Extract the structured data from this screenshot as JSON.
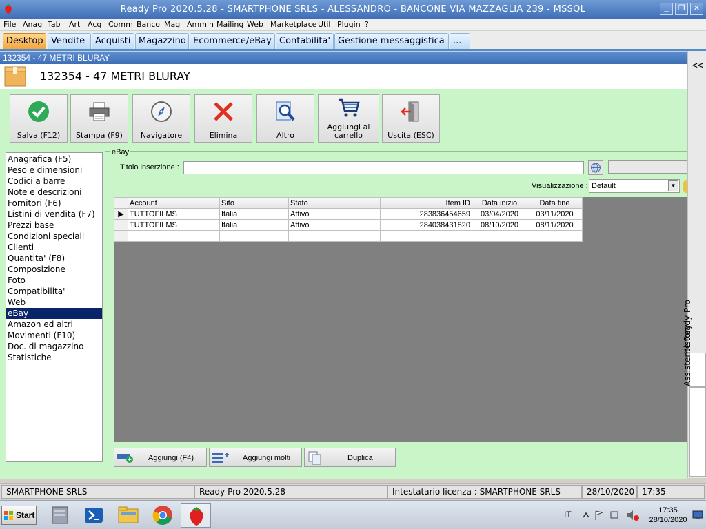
{
  "window": {
    "title": "Ready Pro 2020.5.28 - SMARTPHONE SRLS - ALESSANDRO - BANCONE VIA MAZZAGLIA 239 - MSSQL",
    "minimize": "_",
    "restore": "❐",
    "close": "✕"
  },
  "menu": [
    "File",
    "Anag",
    "Tab",
    "Art",
    "Acq",
    "Comm",
    "Banco",
    "Mag",
    "Ammin",
    "Mailing",
    "Web",
    "Marketplace",
    "Util",
    "Plugin",
    "?"
  ],
  "tabs": [
    "Desktop",
    "Vendite",
    "Acquisti",
    "Magazzino",
    "Ecommerce/eBay",
    "Contabilita'",
    "Gestione messaggistica",
    "..."
  ],
  "active_tab": "Desktop",
  "form": {
    "caption": "132354 - 47 METRI BLURAY",
    "title": "132354 - 47 METRI BLURAY"
  },
  "toolbar": {
    "save": "Salva (F12)",
    "print": "Stampa (F9)",
    "navigator": "Navigatore",
    "delete": "Elimina",
    "other": "Altro",
    "cart_line1": "Aggiungi al",
    "cart_line2": "carrello",
    "exit": "Uscita (ESC)"
  },
  "sidebar": {
    "items": [
      "Anagrafica (F5)",
      "Peso e dimensioni",
      "Codici a barre",
      "Note e descrizioni",
      "Fornitori (F6)",
      "Listini di vendita (F7)",
      "Prezzi base",
      "Condizioni speciali",
      "Clienti",
      "Quantita' (F8)",
      "Composizione",
      "Foto",
      "Compatibilita'",
      "Web",
      "eBay",
      "Amazon ed altri",
      "Movimenti (F10)",
      "Doc. di magazzino",
      "Statistiche"
    ],
    "selected": "eBay"
  },
  "ebay": {
    "group_label": "eBay",
    "title_label": "Titolo inserzione :",
    "title_value": "",
    "view_label": "Visualizzazione :",
    "view_value": "Default",
    "columns": [
      "Account",
      "Sito",
      "Stato",
      "Item ID",
      "Data inizio",
      "Data fine"
    ],
    "rows": [
      [
        "TUTTOFILMS",
        "Italia",
        "Attivo",
        "283836454659",
        "03/04/2020",
        "03/11/2020"
      ],
      [
        "TUTTOFILMS",
        "Italia",
        "Attivo",
        "284038431820",
        "08/10/2020",
        "08/11/2020"
      ]
    ],
    "add": "Aggiungi (F4)",
    "add_many": "Aggiungi molti",
    "duplicate": "Duplica"
  },
  "rightbar": {
    "collapse": "<<",
    "history": "History",
    "assistant": "Assistente Ready Pro"
  },
  "status": {
    "company": "SMARTPHONE SRLS",
    "version": "Ready Pro 2020.5.28",
    "license": "Intestatario licenza : SMARTPHONE SRLS",
    "date": "28/10/2020",
    "time": "17:35"
  },
  "taskbar": {
    "start": "Start",
    "lang": "IT",
    "clock_time": "17:35",
    "clock_date": "28/10/2020"
  }
}
